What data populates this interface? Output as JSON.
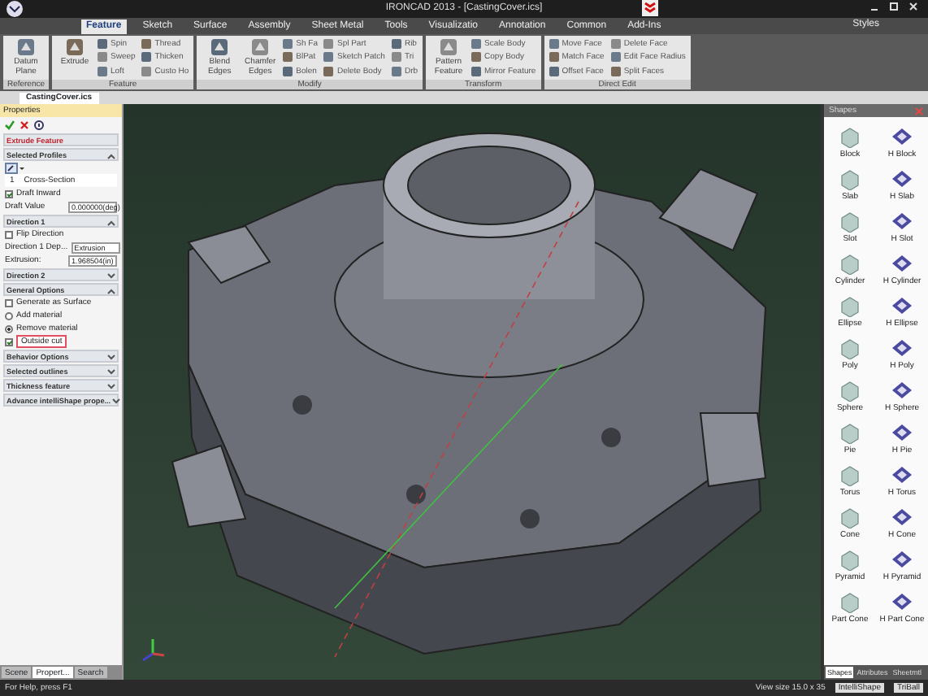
{
  "window": {
    "title": "IRONCAD 2013 - [CastingCover.ics]"
  },
  "ribbon_tabs": [
    {
      "label": "Feature",
      "selected": true
    },
    {
      "label": "Sketch",
      "selected": false
    },
    {
      "label": "Surface",
      "selected": false
    },
    {
      "label": "Assembly",
      "selected": false
    },
    {
      "label": "Sheet Metal",
      "selected": false
    },
    {
      "label": "Tools",
      "selected": false
    },
    {
      "label": "Visualizatio",
      "selected": false
    },
    {
      "label": "Annotation",
      "selected": false
    },
    {
      "label": "Common",
      "selected": false
    },
    {
      "label": "Add-Ins",
      "selected": false
    }
  ],
  "styles_label": "Styles",
  "ribbon_groups": [
    {
      "label": "Reference",
      "items": [
        {
          "label": "Datum Plane",
          "kind": "large"
        }
      ]
    },
    {
      "label": "Feature",
      "items": [
        {
          "label": "Extrude",
          "kind": "large"
        },
        {
          "label": "Spin",
          "kind": "small"
        },
        {
          "label": "Sweep",
          "kind": "small"
        },
        {
          "label": "Loft",
          "kind": "small"
        },
        {
          "label": "Thread",
          "kind": "small"
        },
        {
          "label": "Thicken",
          "kind": "small"
        },
        {
          "label": "Custo Ho",
          "kind": "small"
        }
      ]
    },
    {
      "label": "Modify",
      "items": [
        {
          "label": "Blend Edges",
          "kind": "large"
        },
        {
          "label": "Chamfer Edges",
          "kind": "large"
        },
        {
          "label": "Sh Fa",
          "kind": "small"
        },
        {
          "label": "BlPat",
          "kind": "small"
        },
        {
          "label": "Bolen",
          "kind": "small"
        },
        {
          "label": "Spl Part",
          "kind": "small"
        },
        {
          "label": "Sketch Patch",
          "kind": "small"
        },
        {
          "label": "Delete Body",
          "kind": "small"
        },
        {
          "label": "Rib",
          "kind": "small"
        },
        {
          "label": "Tri",
          "kind": "small"
        },
        {
          "label": "Drb",
          "kind": "small"
        }
      ]
    },
    {
      "label": "Transform",
      "items": [
        {
          "label": "Pattern Feature",
          "kind": "large"
        },
        {
          "label": "Scale Body",
          "kind": "small"
        },
        {
          "label": "Copy Body",
          "kind": "small"
        },
        {
          "label": "Mirror Feature",
          "kind": "small"
        }
      ]
    },
    {
      "label": "Direct Edit",
      "items": [
        {
          "label": "Move Face",
          "kind": "small"
        },
        {
          "label": "Match Face",
          "kind": "small"
        },
        {
          "label": "Offset Face",
          "kind": "small"
        },
        {
          "label": "Delete Face",
          "kind": "small"
        },
        {
          "label": "Edit Face Radius",
          "kind": "small"
        },
        {
          "label": "Split Faces",
          "kind": "small"
        }
      ]
    }
  ],
  "document_tab": "CastingCover.ics",
  "properties": {
    "title": "Properties",
    "feature_title": "Extrude Feature",
    "sections": [
      {
        "title": "Selected Profiles",
        "expanded": true,
        "items": [
          {
            "kind": "picker"
          },
          {
            "kind": "list_row",
            "number": "1",
            "label": "Cross-Section"
          },
          {
            "kind": "checkbox",
            "label": "Draft Inward",
            "checked": true,
            "highlighted": false
          },
          {
            "kind": "field",
            "label": "Draft Value",
            "value": "0.000000(deg)"
          }
        ]
      },
      {
        "title": "Direction 1",
        "expanded": true,
        "items": [
          {
            "kind": "checkbox",
            "label": "Flip Direction",
            "checked": false,
            "highlighted": false
          },
          {
            "kind": "select",
            "label": "Direction 1 Dep...",
            "value": "Extrusion"
          },
          {
            "kind": "field",
            "label": "Extrusion:",
            "value": "1.968504(in)"
          }
        ]
      },
      {
        "title": "Direction 2",
        "expanded": false
      },
      {
        "title": "General Options",
        "expanded": true,
        "items": [
          {
            "kind": "checkbox",
            "label": "Generate as Surface",
            "checked": false,
            "highlighted": false
          },
          {
            "kind": "radio",
            "label": "Add material",
            "selected": false
          },
          {
            "kind": "radio",
            "label": "Remove material",
            "selected": true
          },
          {
            "kind": "checkbox",
            "label": "Outside cut",
            "checked": true,
            "highlighted": true
          }
        ]
      },
      {
        "title": "Behavior Options",
        "expanded": false
      },
      {
        "title": "Selected outlines",
        "expanded": false
      },
      {
        "title": "Thickness feature",
        "expanded": false
      },
      {
        "title": "Advance intelliShape prope...",
        "expanded": false
      }
    ]
  },
  "left_tabs": [
    {
      "label": "Scene",
      "selected": false
    },
    {
      "label": "Propert...",
      "selected": true
    },
    {
      "label": "Search",
      "selected": false
    }
  ],
  "catalog": {
    "title": "Shapes",
    "items": [
      {
        "label": "Block",
        "kind": "solid"
      },
      {
        "label": "H Block",
        "kind": "hollow"
      },
      {
        "label": "Slab",
        "kind": "solid"
      },
      {
        "label": "H Slab",
        "kind": "hollow"
      },
      {
        "label": "Slot",
        "kind": "solid"
      },
      {
        "label": "H Slot",
        "kind": "hollow"
      },
      {
        "label": "Cylinder",
        "kind": "solid"
      },
      {
        "label": "H Cylinder",
        "kind": "hollow"
      },
      {
        "label": "Ellipse",
        "kind": "solid"
      },
      {
        "label": "H Ellipse",
        "kind": "hollow"
      },
      {
        "label": "Poly",
        "kind": "solid"
      },
      {
        "label": "H Poly",
        "kind": "hollow"
      },
      {
        "label": "Sphere",
        "kind": "solid"
      },
      {
        "label": "H Sphere",
        "kind": "hollow"
      },
      {
        "label": "Pie",
        "kind": "solid"
      },
      {
        "label": "H Pie",
        "kind": "hollow"
      },
      {
        "label": "Torus",
        "kind": "solid"
      },
      {
        "label": "H Torus",
        "kind": "hollow"
      },
      {
        "label": "Cone",
        "kind": "solid"
      },
      {
        "label": "H Cone",
        "kind": "hollow"
      },
      {
        "label": "Pyramid",
        "kind": "solid"
      },
      {
        "label": "H Pyramid",
        "kind": "hollow"
      },
      {
        "label": "Part Cone",
        "kind": "solid"
      },
      {
        "label": "H Part Cone",
        "kind": "hollow"
      }
    ],
    "tabs": [
      {
        "label": "Shapes",
        "selected": true
      },
      {
        "label": "Attributes",
        "selected": false
      },
      {
        "label": "Sheetmtl",
        "selected": false
      }
    ]
  },
  "status_bar": {
    "help": "For Help, press F1",
    "view_size": "View size 15.0 x 35",
    "mode": "IntelliShape",
    "tool": "TriBall"
  }
}
